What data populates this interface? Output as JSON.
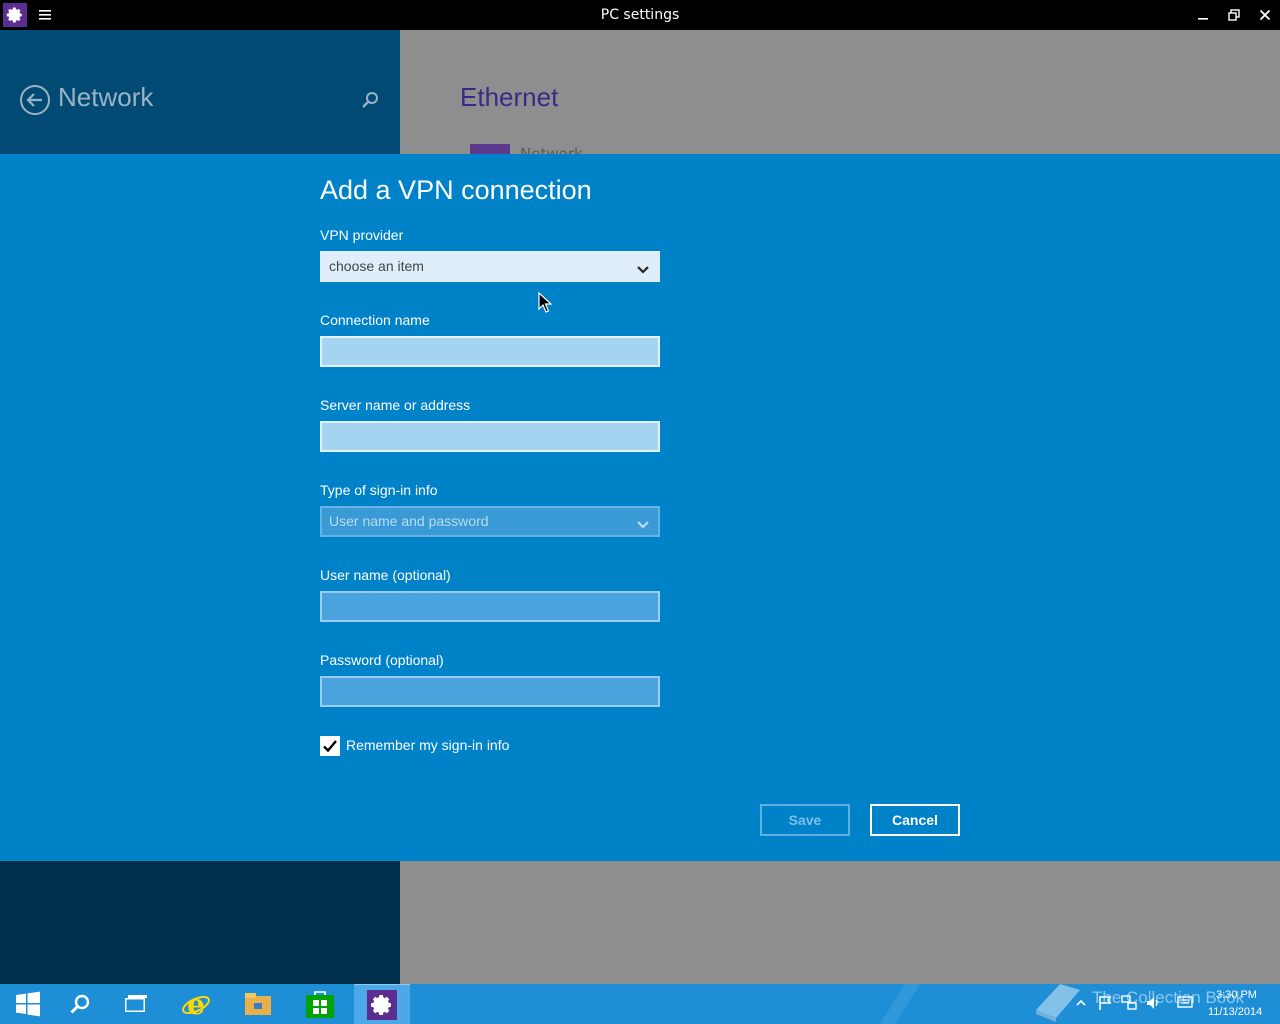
{
  "window": {
    "title": "PC settings"
  },
  "nav": {
    "title": "Network",
    "section_title": "Ethernet",
    "network_item": "Network"
  },
  "dialog": {
    "title": "Add a VPN connection",
    "vpn_provider": {
      "label": "VPN provider",
      "value": "choose an item"
    },
    "connection_name": {
      "label": "Connection name",
      "value": ""
    },
    "server": {
      "label": "Server name or address",
      "value": ""
    },
    "signin_type": {
      "label": "Type of sign-in info",
      "value": "User name and password"
    },
    "username": {
      "label": "User name (optional)",
      "value": ""
    },
    "password": {
      "label": "Password (optional)",
      "value": ""
    },
    "remember": {
      "label": "Remember my sign-in info",
      "checked": true
    },
    "save_label": "Save",
    "cancel_label": "Cancel"
  },
  "taskbar": {
    "items": [
      "start-icon",
      "search-icon",
      "task-view-icon",
      "internet-explorer-icon",
      "file-explorer-icon",
      "store-icon",
      "settings-icon"
    ],
    "active_item": "settings-icon",
    "clock_time": "3:30 PM",
    "clock_date": "11/13/2014",
    "watermark": "The Collection Book"
  },
  "colors": {
    "dialog_bg": "#0082c9",
    "left_pane": "#00304c",
    "right_pane": "#8e8e8e",
    "taskbar": "#1e8ed6",
    "accent": "#5c2d91"
  }
}
